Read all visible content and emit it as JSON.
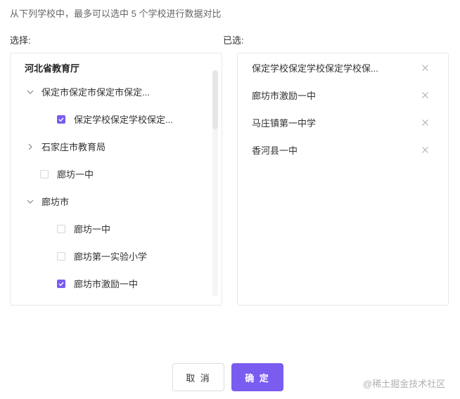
{
  "instruction": "从下列学校中，最多可以选中 5 个学校进行数据对比",
  "left_label": "选择:",
  "right_label": "已选:",
  "tree": {
    "root": "河北省教育厅",
    "items": [
      {
        "label": "保定市保定市保定市保定...",
        "level": 0,
        "expander": "chevron-down",
        "checkbox": null
      },
      {
        "label": "保定学校保定学校保定...",
        "level": 1,
        "expander": null,
        "checkbox": "checked"
      },
      {
        "label": "石家庄市教育局",
        "level": 0,
        "expander": "chevron-right",
        "checkbox": null
      },
      {
        "label": "廊坊一中",
        "level": 0,
        "expander": null,
        "checkbox": "unchecked"
      },
      {
        "label": "廊坊市",
        "level": 0,
        "expander": "chevron-down",
        "checkbox": null
      },
      {
        "label": "廊坊一中",
        "level": 1,
        "expander": null,
        "checkbox": "unchecked"
      },
      {
        "label": "廊坊第一实验小学",
        "level": 1,
        "expander": null,
        "checkbox": "unchecked"
      },
      {
        "label": "廊坊市激励一中",
        "level": 1,
        "expander": null,
        "checkbox": "checked"
      }
    ]
  },
  "selected": [
    {
      "label": "保定学校保定学校保定学校保..."
    },
    {
      "label": "廊坊市激励一中"
    },
    {
      "label": "马庄镇第一中学"
    },
    {
      "label": "香河县一中"
    }
  ],
  "buttons": {
    "cancel": "取 消",
    "confirm": "确 定"
  },
  "watermark": "@稀土掘金技术社区",
  "colors": {
    "accent": "#7b5cf0",
    "border": "#e8e8e8",
    "text": "#333333"
  }
}
